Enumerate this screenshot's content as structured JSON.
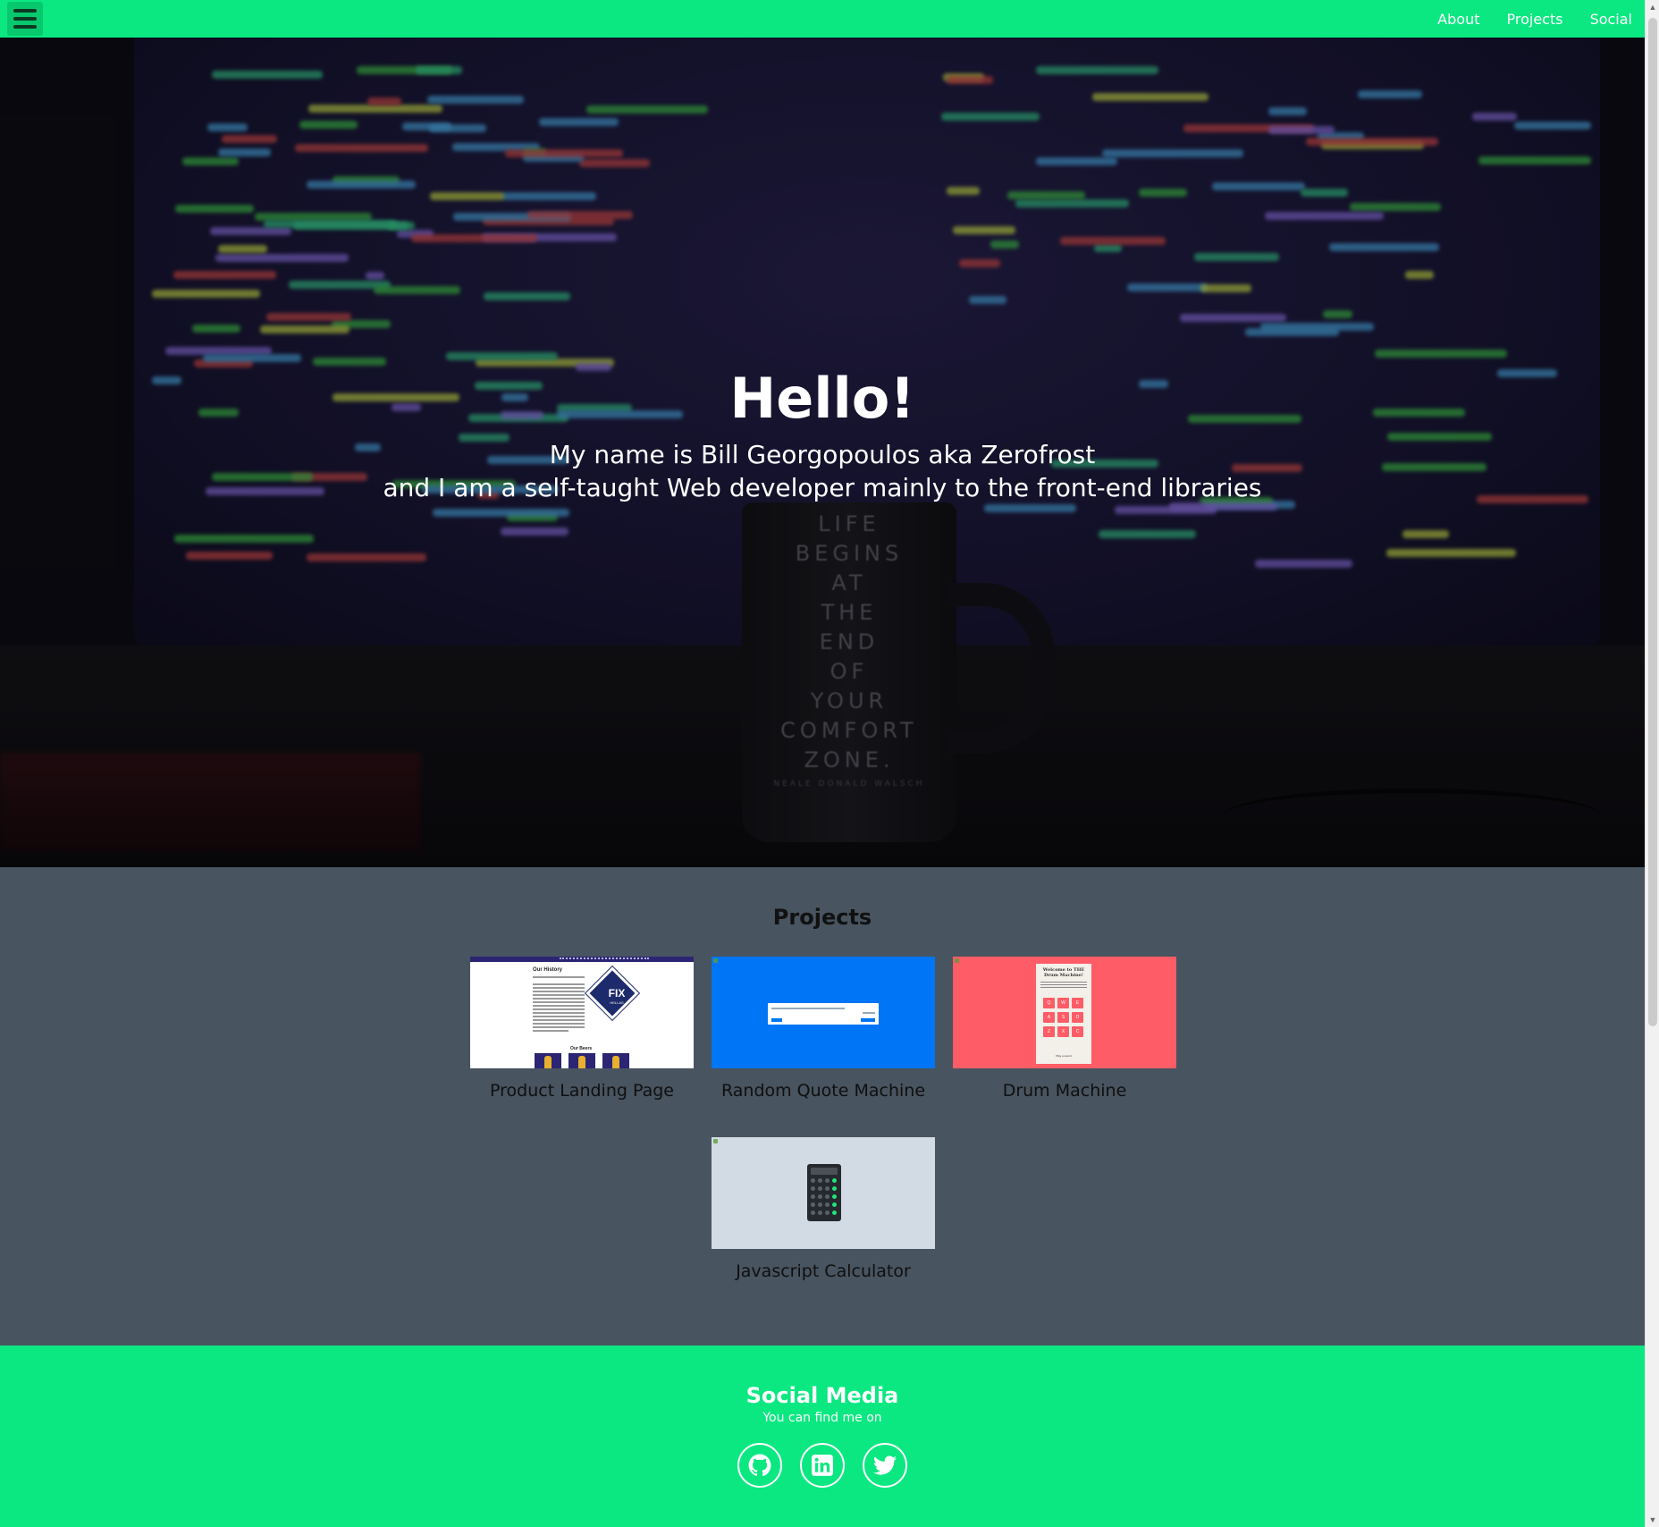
{
  "navbar": {
    "menu_icon": "hamburger-menu-icon",
    "links": [
      "About",
      "Projects",
      "Social"
    ]
  },
  "hero": {
    "title": "Hello!",
    "subtitle_line1": "My name is Bill Georgopoulos aka Zerofrost",
    "subtitle_line2": "and I am a self-taught Web developer mainly to the front-end libraries",
    "background_mug_text": [
      "LIFE",
      "BEGINS",
      "AT",
      "THE",
      "END",
      "OF",
      "YOUR",
      "COMFORT",
      "ZONE."
    ],
    "background_mug_author": "NEALE DONALD WALSCH"
  },
  "projects": {
    "title": "Projects",
    "items": [
      {
        "label": "Product Landing Page",
        "thumb": {
          "heading": "Our History",
          "badge": "FIX",
          "badge_sub": "HELLAS",
          "section": "Our Beers"
        }
      },
      {
        "label": "Random Quote Machine"
      },
      {
        "label": "Drum Machine",
        "thumb": {
          "title": "Welcome to THE Drum Machine!",
          "keys": [
            "Q",
            "W",
            "E",
            "A",
            "S",
            "D",
            "Z",
            "X",
            "C"
          ],
          "footer": "Play a sound"
        }
      },
      {
        "label": "Javascript Calculator"
      }
    ]
  },
  "social": {
    "title": "Social Media",
    "subtitle": "You can find me on",
    "icons": [
      "github-icon",
      "linkedin-icon",
      "twitter-icon"
    ]
  },
  "colors": {
    "accent_green": "#0be881",
    "projects_bg": "#485460",
    "hero_text": "#ffffff"
  }
}
